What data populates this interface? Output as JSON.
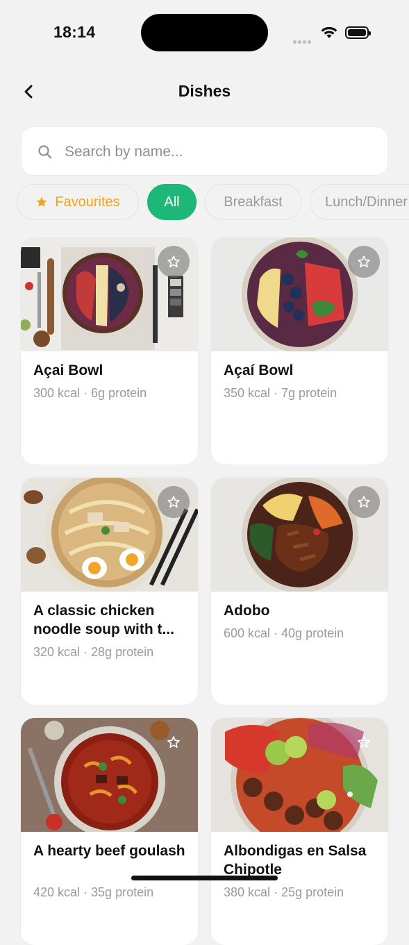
{
  "status_bar": {
    "time": "18:14"
  },
  "header": {
    "title": "Dishes"
  },
  "search": {
    "placeholder": "Search by name..."
  },
  "chips": {
    "favourites": "Favourites",
    "all": "All",
    "breakfast": "Breakfast",
    "lunch_dinner": "Lunch/Dinner"
  },
  "dishes": [
    {
      "name": "Açai Bowl",
      "meta": "300 kcal · 6g protein"
    },
    {
      "name": "Açaí Bowl",
      "meta": "350 kcal · 7g protein"
    },
    {
      "name": "A classic chicken noodle soup with t...",
      "meta": "320 kcal · 28g protein"
    },
    {
      "name": "Adobo",
      "meta": "600 kcal · 40g protein"
    },
    {
      "name": "A hearty beef goulash",
      "meta": "420 kcal · 35g protein"
    },
    {
      "name": "Albondigas en Salsa Chipotle",
      "meta": "380 kcal · 25g protein"
    }
  ],
  "colors": {
    "accent": "#1db877",
    "favourite": "#f0a31c"
  }
}
